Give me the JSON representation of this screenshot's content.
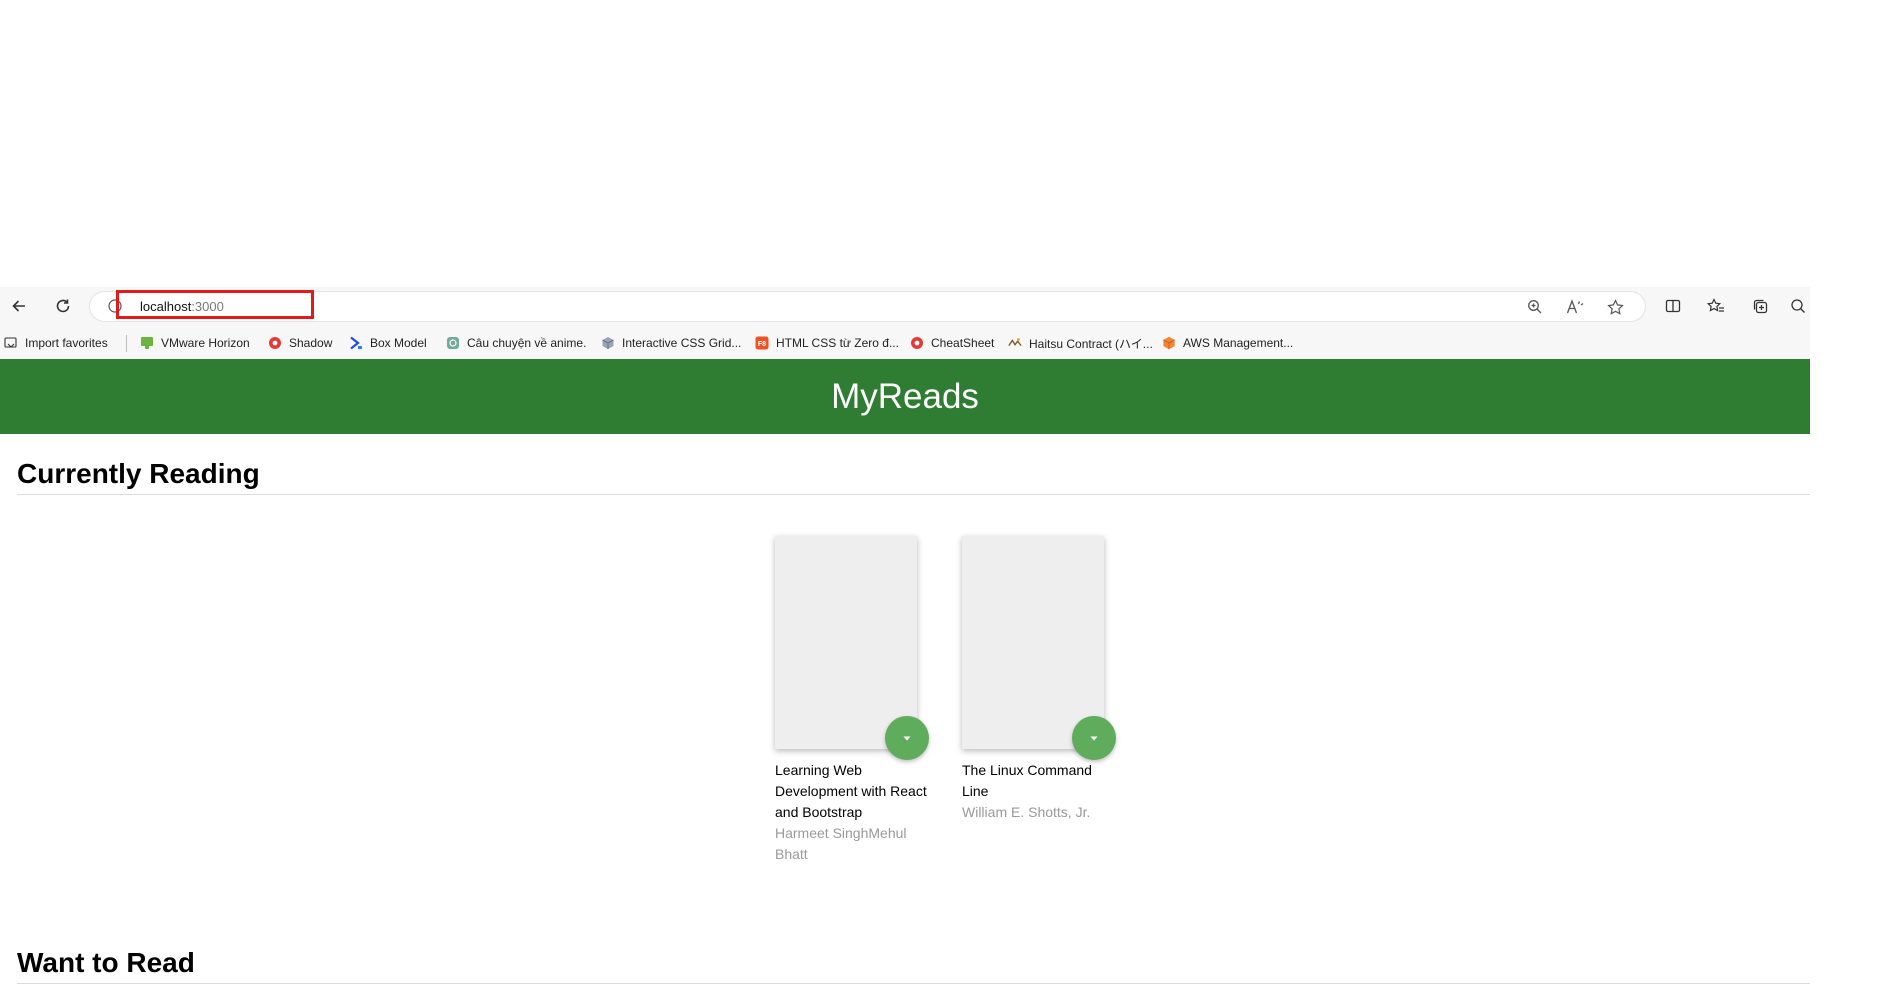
{
  "browser": {
    "url_host": "localhost",
    "url_port": ":3000",
    "bookmarks": [
      {
        "label": "Import favorites",
        "icon": "import-icon"
      },
      {
        "label": "VMware Horizon",
        "icon": "vmware-icon"
      },
      {
        "label": "Shadow",
        "icon": "shadow-icon"
      },
      {
        "label": "Box Model",
        "icon": "box-model-icon"
      },
      {
        "label": "Câu chuyện về anime.",
        "icon": "chatgpt-icon"
      },
      {
        "label": "Interactive CSS Grid...",
        "icon": "cube-icon"
      },
      {
        "label": "HTML CSS từ Zero đ...",
        "icon": "f8-icon"
      },
      {
        "label": "CheatSheet",
        "icon": "cheatsheet-icon"
      },
      {
        "label": "Haitsu Contract (ハイ...",
        "icon": "haitsu-icon"
      },
      {
        "label": "AWS Management...",
        "icon": "aws-icon"
      }
    ]
  },
  "app": {
    "title": "MyReads",
    "header_color": "#2e7d32",
    "button_color": "#60ac5d"
  },
  "shelves": [
    {
      "title": "Currently Reading",
      "books": [
        {
          "title": "Learning Web Development with React and Bootstrap",
          "authors": "Harmeet SinghMehul Bhatt"
        },
        {
          "title": "The Linux Command Line",
          "authors": "William E. Shotts, Jr."
        }
      ]
    },
    {
      "title": "Want to Read",
      "books": []
    }
  ]
}
